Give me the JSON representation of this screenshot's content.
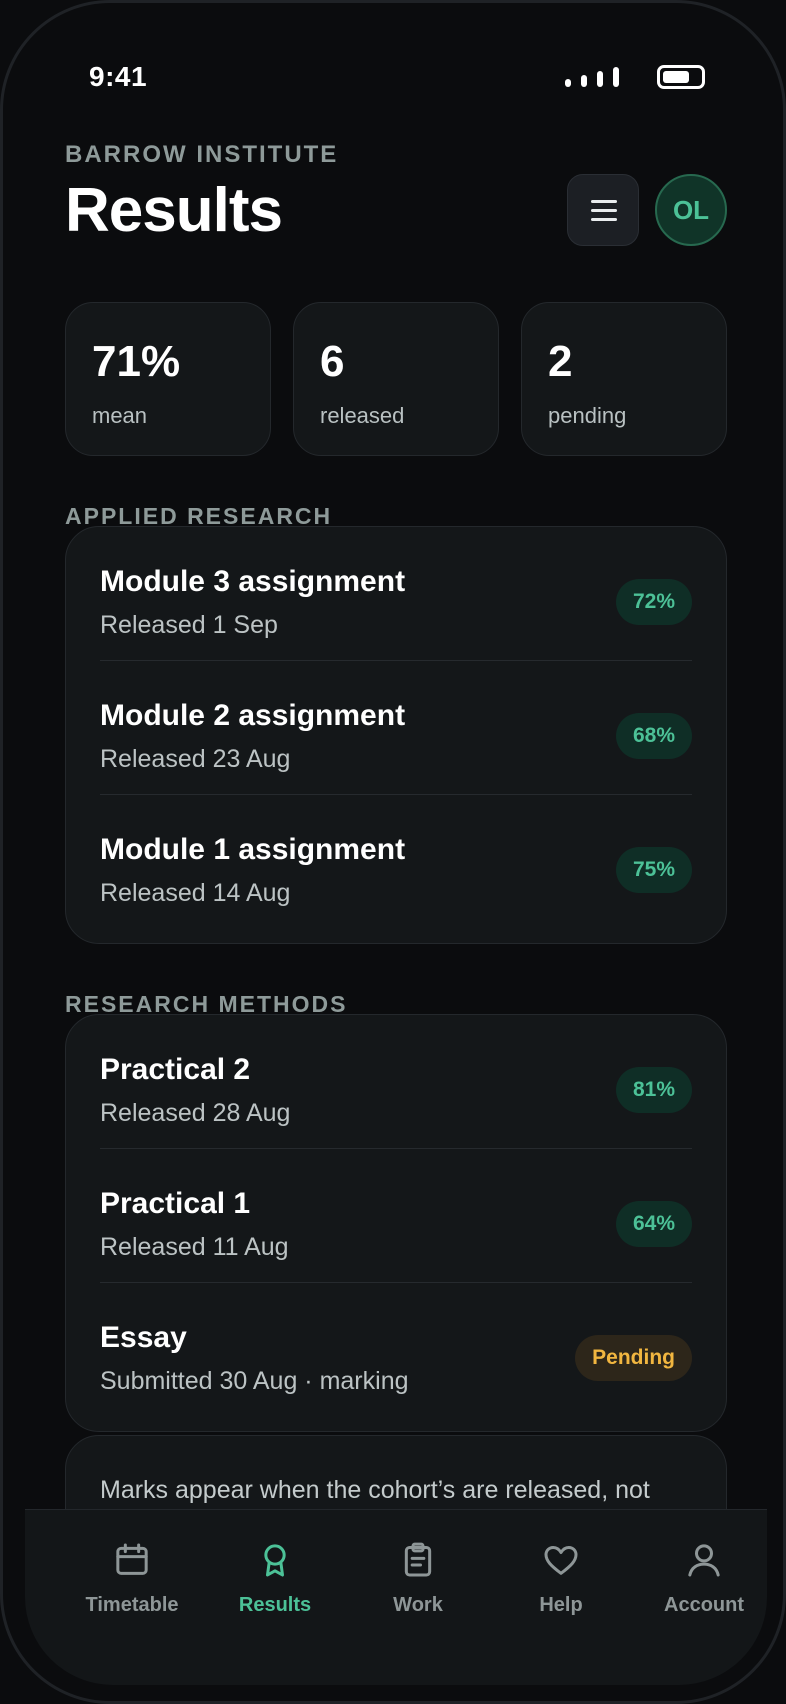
{
  "status_bar": {
    "time": "9:41"
  },
  "header": {
    "eyebrow": "BARROW INSTITUTE",
    "title": "Results",
    "menu_icon": "menu-icon",
    "avatar_initials": "OL"
  },
  "stats": [
    {
      "value": "71%",
      "label": "mean"
    },
    {
      "value": "6",
      "label": "released"
    },
    {
      "value": "2",
      "label": "pending"
    }
  ],
  "sections": [
    {
      "title": "APPLIED RESEARCH",
      "items": [
        {
          "title": "Module 3 assignment",
          "subtitle": "Released 1 Sep",
          "badge": "72%",
          "status": "released"
        },
        {
          "title": "Module 2 assignment",
          "subtitle": "Released 23 Aug",
          "badge": "68%",
          "status": "released"
        },
        {
          "title": "Module 1 assignment",
          "subtitle": "Released 14 Aug",
          "badge": "75%",
          "status": "released"
        }
      ]
    },
    {
      "title": "RESEARCH METHODS",
      "items": [
        {
          "title": "Practical 2",
          "subtitle": "Released 28 Aug",
          "badge": "81%",
          "status": "released"
        },
        {
          "title": "Practical 1",
          "subtitle": "Released 11 Aug",
          "badge": "64%",
          "status": "released"
        },
        {
          "title": "Essay",
          "subtitle": "Submitted 30 Aug · marking",
          "badge": "Pending",
          "status": "pending"
        }
      ]
    }
  ],
  "note": "Marks appear when the cohort’s are released, not",
  "tabbar": {
    "active": "Results",
    "tabs": [
      {
        "label": "Timetable",
        "icon": "calendar-icon"
      },
      {
        "label": "Results",
        "icon": "award-icon"
      },
      {
        "label": "Work",
        "icon": "clipboard-icon"
      },
      {
        "label": "Help",
        "icon": "heart-icon"
      },
      {
        "label": "Account",
        "icon": "user-icon"
      }
    ]
  },
  "colors": {
    "background": "#0b0c0e",
    "card": "#141719",
    "accent": "#4cc197",
    "badge_bg": "#0f2e26",
    "pending": "#f1b640",
    "pending_bg": "#2d261a"
  }
}
